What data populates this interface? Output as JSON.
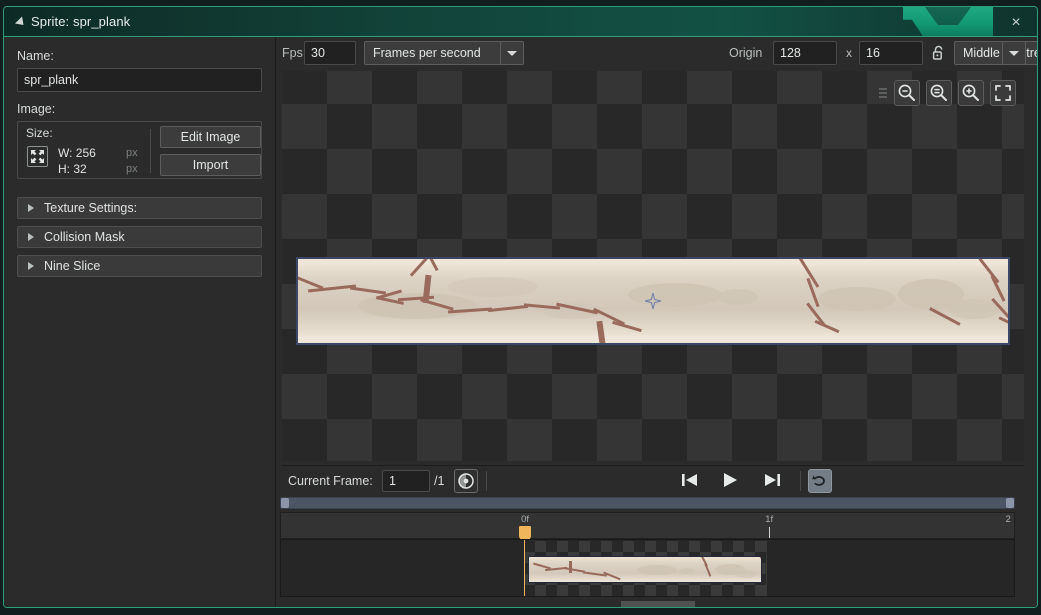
{
  "window": {
    "title": "Sprite: spr_plank",
    "close_label": "×",
    "accent_color": "#2e9e78",
    "titlebar_color": "#12443a"
  },
  "left_panel": {
    "name_label": "Name:",
    "name_value": "spr_plank",
    "image_label": "Image:",
    "size_caption": "Size:",
    "width_text": "W: 256",
    "height_text": "H: 32",
    "px_unit_1": "px",
    "px_unit_2": "px",
    "edit_image_label": "Edit Image",
    "import_label": "Import",
    "sections": [
      {
        "label": "Texture Settings:"
      },
      {
        "label": "Collision Mask"
      },
      {
        "label": "Nine Slice"
      }
    ]
  },
  "toolbar": {
    "fps_label": "Fps",
    "fps_value": "30",
    "fps_mode": "Frames per second",
    "origin_label": "Origin",
    "origin_x": "128",
    "origin_separator": "x",
    "origin_y": "16",
    "origin_preset": "Middle Centre",
    "lock_state": "unlocked"
  },
  "canvas": {
    "zoom_buttons": [
      {
        "name": "zoom-out-button"
      },
      {
        "name": "zoom-reset-button"
      },
      {
        "name": "zoom-in-button"
      },
      {
        "name": "fit-to-screen-button"
      }
    ],
    "sprite_name": "spr_plank",
    "origin_marker": "origin-crosshair",
    "selection_border_color": "#3c4768",
    "plank_base_color": "#ded4c6",
    "plank_crack_color": "#9a6a5c"
  },
  "playback": {
    "current_frame_label": "Current Frame:",
    "current_frame_value": "1",
    "total_frames": "/1",
    "onion_skin": "onion-skin-toggle",
    "prev_frame": "previous-frame-button",
    "play": "play-button",
    "next_frame": "next-frame-button",
    "loop": "loop-toggle"
  },
  "timeline": {
    "ticks": [
      {
        "label": "0f",
        "pos_pct": 33.3
      },
      {
        "label": "1f",
        "pos_pct": 66.6
      },
      {
        "label": "2",
        "pos_pct": 99.6
      }
    ],
    "playhead_pos_pct": 33.3,
    "playhead_color": "#f0b45a",
    "frames": [
      {
        "index": 1,
        "left_pct": 33.3
      }
    ]
  }
}
